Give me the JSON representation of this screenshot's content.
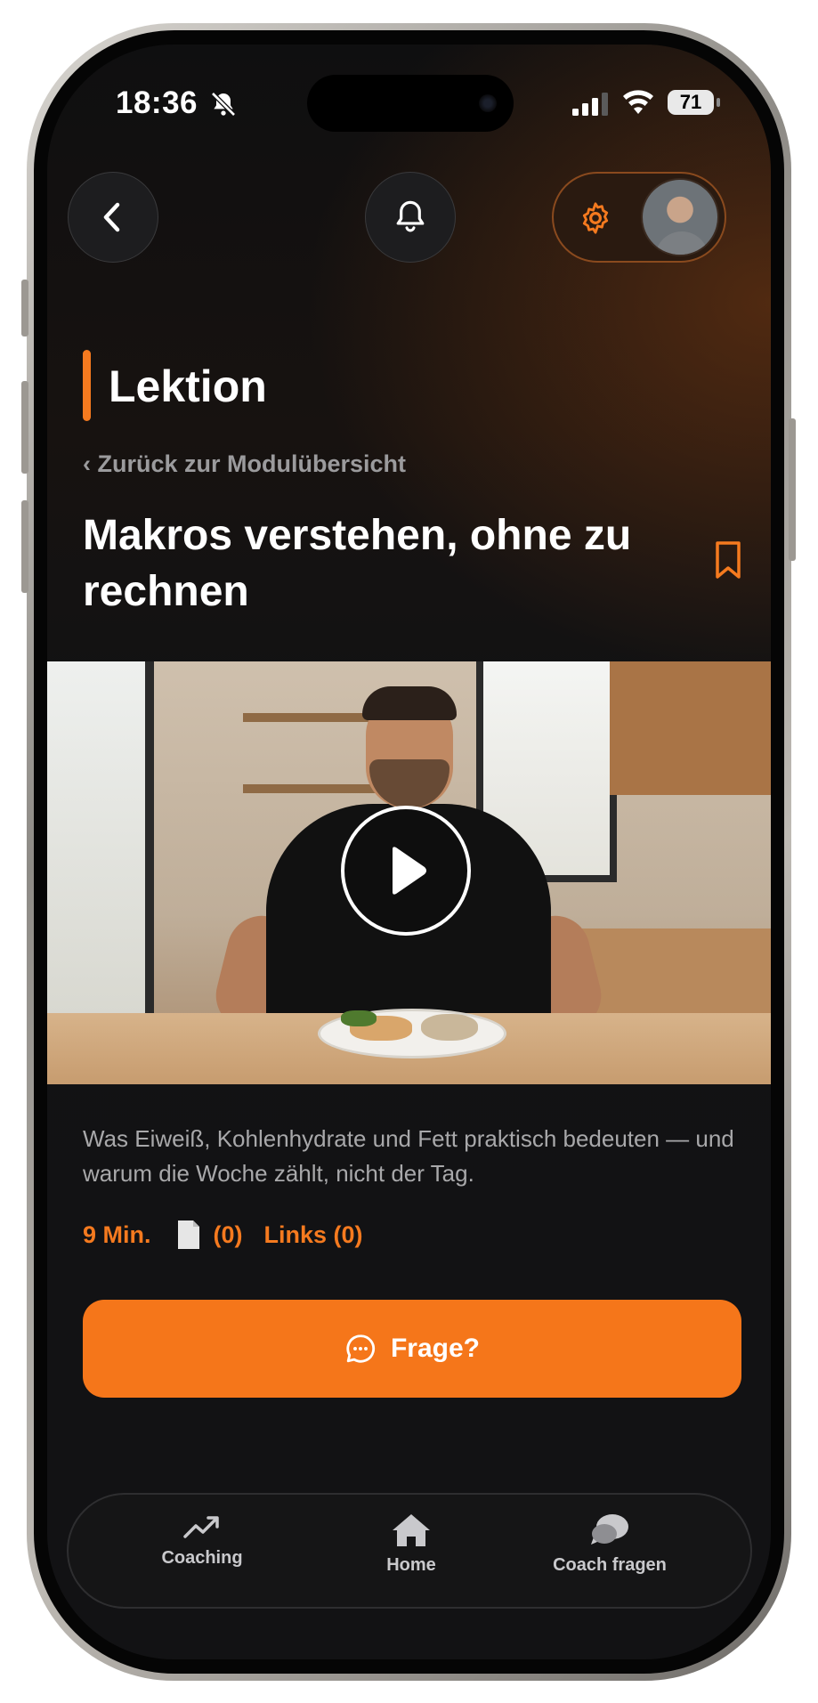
{
  "status_bar": {
    "time": "18:36",
    "battery": "71"
  },
  "section": {
    "title": "Lektion"
  },
  "back_link": "‹ Zurück zur Modulübersicht",
  "lesson": {
    "title": "Makros verstehen, ohne zu rechnen",
    "description": "Was Eiweiß, Kohlenhydrate und Fett praktisch bedeuten — und warum die Woche zählt, nicht der Tag.",
    "duration": "9 Min.",
    "documents": "(0)",
    "links": "Links (0)"
  },
  "ask_button": {
    "label": "Frage?"
  },
  "tabbar": {
    "items": [
      {
        "label": "Coaching",
        "icon": "trend-up-icon"
      },
      {
        "label": "Home",
        "icon": "home-icon"
      },
      {
        "label": "Coach fragen",
        "icon": "chat-bubbles-icon"
      }
    ]
  },
  "colors": {
    "accent": "#f57a1f",
    "background": "#121214"
  }
}
